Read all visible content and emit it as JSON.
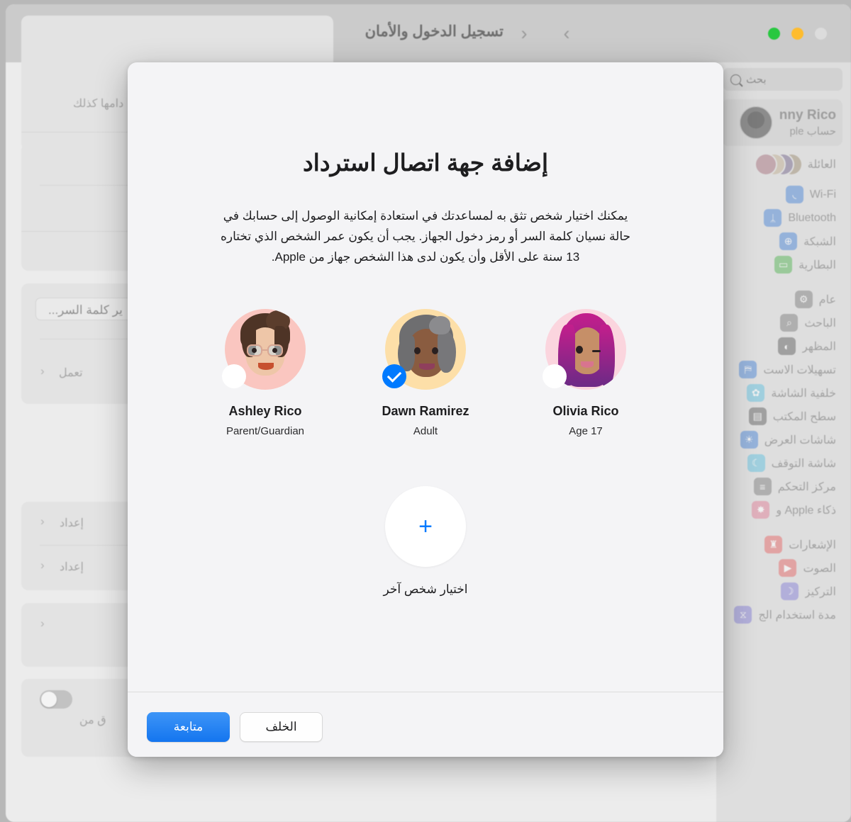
{
  "window": {
    "title": "تسجيل الدخول والأمان",
    "nav_back_icon": "chevron-left-icon",
    "nav_forward_icon": "chevron-right-icon",
    "traffic_lights": {
      "green": "#28c840",
      "yellow": "#febc2e",
      "gray": "#dcdcdc"
    }
  },
  "sidebar": {
    "search": {
      "placeholder": "بحث",
      "icon": "search-icon"
    },
    "account": {
      "name": "nny Rico",
      "subtitle": "حساب ple"
    },
    "family": {
      "label": "العائلة"
    },
    "items": [
      {
        "label": "Wi-Fi",
        "icon": "wifi-icon",
        "color": "#5b8fd8"
      },
      {
        "label": "Bluetooth",
        "icon": "bluetooth-icon",
        "color": "#5b8fd8"
      },
      {
        "label": "الشبكة",
        "icon": "globe-icon",
        "color": "#5b8fd8"
      },
      {
        "label": "البطارية",
        "icon": "battery-icon",
        "color": "#63b863"
      },
      {
        "label": "عام",
        "icon": "gear-icon",
        "color": "#8a8a8a"
      },
      {
        "label": "الباحث",
        "icon": "magnifier-icon",
        "color": "#8a8a8a"
      },
      {
        "label": "المظهر",
        "icon": "appearance-icon",
        "color": "#6e6e6e"
      },
      {
        "label": "تسهيلات الاست",
        "icon": "accessibility-icon",
        "color": "#5b8fd8"
      },
      {
        "label": "خلفية الشاشة",
        "icon": "wallpaper-icon",
        "color": "#6fc4de"
      },
      {
        "label": "سطح المكتب",
        "icon": "desktop-icon",
        "color": "#6e6e6e"
      },
      {
        "label": "شاشات العرض",
        "icon": "display-icon",
        "color": "#5b8fd8"
      },
      {
        "label": "شاشة التوقف",
        "icon": "screensaver-icon",
        "color": "#6fc4de"
      },
      {
        "label": "مركز التحكم",
        "icon": "control-center-icon",
        "color": "#8a8a8a"
      },
      {
        "label": "ذكاء Apple و",
        "icon": "apple-intelligence-icon",
        "color": "#e08aa0"
      },
      {
        "label": "الإشعارات",
        "icon": "notifications-icon",
        "color": "#e57373"
      },
      {
        "label": "الصوت",
        "icon": "sound-icon",
        "color": "#e57373"
      },
      {
        "label": "التركيز",
        "icon": "focus-icon",
        "color": "#8f8ad8"
      },
      {
        "label": "مدة استخدام الج",
        "icon": "screen-time-icon",
        "color": "#8f8ad8"
      }
    ]
  },
  "background_pane": {
    "row_note": "دامها كذلك",
    "password_pill": "ير كلمة السر...",
    "status_row": "تعمل",
    "setup_row_1": "إعداد",
    "setup_row_2": "إعداد",
    "toggle_row_text": "ق من",
    "chevron_icon": "chevron-left-icon"
  },
  "modal": {
    "title": "إضافة جهة اتصال استرداد",
    "description": "يمكنك اختيار شخص تثق به لمساعدتك في استعادة إمكانية الوصول إلى حسابك في حالة نسيان كلمة السر أو رمز دخول الجهاز. يجب أن يكون عمر الشخص الذي تختاره 13 سنة على الأقل وأن يكون لدى هذا الشخص جهاز من Apple.",
    "people": [
      {
        "name": "Ashley Rico",
        "role": "Parent/Guardian",
        "selected": false,
        "bg": "#fac6c0"
      },
      {
        "name": "Dawn Ramirez",
        "role": "Adult",
        "selected": true,
        "bg": "#fddfa8"
      },
      {
        "name": "Olivia Rico",
        "role": "Age 17",
        "selected": false,
        "bg": "#fbd5de"
      }
    ],
    "add_person": {
      "label": "اختيار شخص آخر",
      "icon": "plus-icon"
    },
    "buttons": {
      "continue": "متابعة",
      "back": "الخلف",
      "accent": "#007aff"
    },
    "check_icon": "check-icon"
  }
}
